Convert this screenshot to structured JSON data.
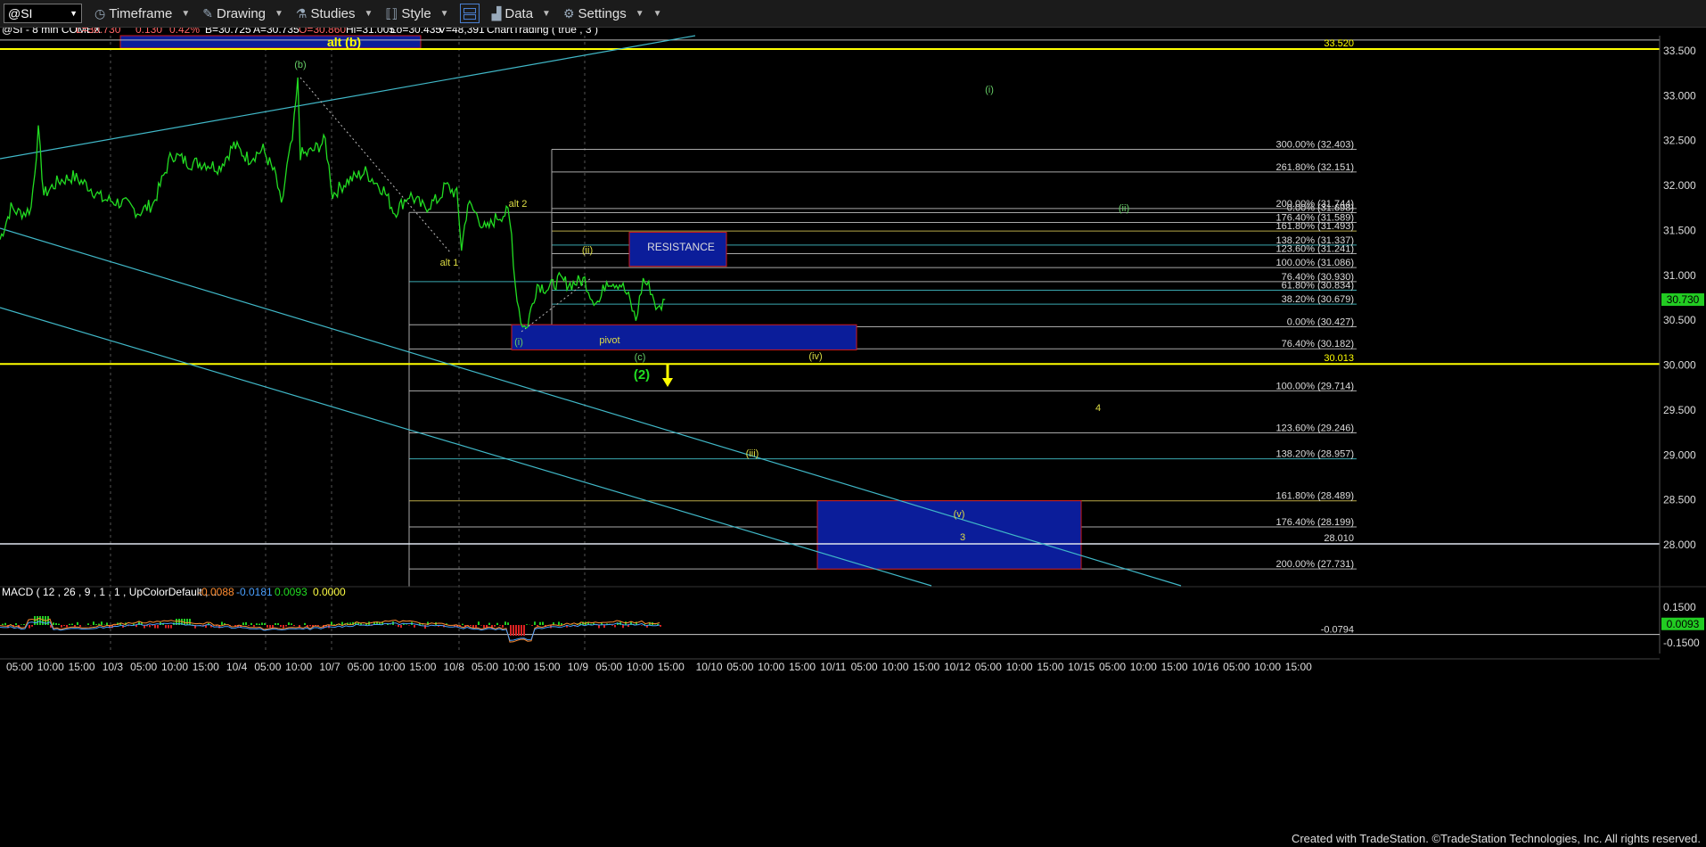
{
  "toolbar": {
    "symbol": "@SI",
    "timeframe": "Timeframe",
    "drawing": "Drawing",
    "studies": "Studies",
    "style": "Style",
    "data": "Data",
    "settings": "Settings"
  },
  "header": {
    "symbol_info": "@SI - 8 min  COMEX",
    "L": "L=30.730",
    "chg": "0.130",
    "pct": "0.42%",
    "B": "B=30.725",
    "A": "A=30.735",
    "O": "O=30.860",
    "Hi": "Hi=31.005",
    "Lo": "Lo=30.435",
    "V": "V=48,391",
    "study": "ChartTrading ( true , 3 )"
  },
  "colors": {
    "price": "#22dd22",
    "yellow": "#ffff00",
    "teal": "#40b8c8",
    "box_fill": "#0b1d9a",
    "box_border": "#d01818",
    "fib": "#a8a8a8",
    "grid": "#2a2a2a"
  },
  "chart_data": [
    {
      "type": "line",
      "name": "price",
      "yaxis": {
        "ylim": [
          27.4,
          33.75
        ],
        "ticks": [
          28.0,
          28.5,
          29.0,
          29.5,
          30.0,
          30.5,
          31.0,
          31.5,
          32.0,
          32.5,
          33.0,
          33.5
        ],
        "tick_labels": [
          "28.000",
          "28.500",
          "29.000",
          "29.500",
          "30.000",
          "30.500",
          "31.000",
          "31.500",
          "32.000",
          "32.500",
          "33.000",
          "33.500"
        ]
      },
      "x_labels": [
        "05:00",
        "10:00",
        "15:00",
        "10/3",
        "05:00",
        "10:00",
        "15:00",
        "10/4",
        "05:00",
        "10:00",
        "10/7",
        "05:00",
        "10:00",
        "15:00",
        "10/8",
        "05:00",
        "10:00",
        "15:00",
        "10/9",
        "05:00",
        "10:00",
        "15:00",
        "10/10",
        "05:00",
        "10:00",
        "15:00",
        "10/11",
        "05:00",
        "10:00",
        "15:00",
        "10/12",
        "05:00",
        "10:00",
        "15:00",
        "10/15",
        "05:00",
        "10:00",
        "15:00",
        "10/16",
        "05:00",
        "10:00",
        "15:00"
      ],
      "day_separators": [
        "10/3",
        "10/4",
        "10/7",
        "10/8",
        "10/9"
      ],
      "path": [
        [
          0,
          31.4
        ],
        [
          0.03,
          31.75
        ],
        [
          0.05,
          31.7
        ],
        [
          0.07,
          31.7
        ],
        [
          0.085,
          31.75
        ],
        [
          0.105,
          32.6
        ],
        [
          0.12,
          31.9
        ],
        [
          0.16,
          32.05
        ],
        [
          0.2,
          32.1
        ],
        [
          0.24,
          32.0
        ],
        [
          0.28,
          31.85
        ],
        [
          0.34,
          31.8
        ],
        [
          0.38,
          31.7
        ],
        [
          0.42,
          31.8
        ],
        [
          0.47,
          32.35
        ],
        [
          0.52,
          32.25
        ],
        [
          0.56,
          32.25
        ],
        [
          0.6,
          32.2
        ],
        [
          0.64,
          32.45
        ],
        [
          0.68,
          32.3
        ],
        [
          0.72,
          32.4
        ],
        [
          0.755,
          32.1
        ],
        [
          0.77,
          31.75
        ],
        [
          0.785,
          32.2
        ],
        [
          0.8,
          32.5
        ],
        [
          0.815,
          33.15
        ],
        [
          0.822,
          32.35
        ],
        [
          0.84,
          32.35
        ],
        [
          0.86,
          32.4
        ],
        [
          0.89,
          32.5
        ],
        [
          0.91,
          31.9
        ],
        [
          0.95,
          32.05
        ],
        [
          1.0,
          32.15
        ],
        [
          1.05,
          31.95
        ],
        [
          1.08,
          31.7
        ],
        [
          1.12,
          31.9
        ],
        [
          1.16,
          31.75
        ],
        [
          1.2,
          31.85
        ],
        [
          1.22,
          32.0
        ],
        [
          1.25,
          31.9
        ],
        [
          1.263,
          31.3
        ],
        [
          1.28,
          31.8
        ],
        [
          1.3,
          31.7
        ],
        [
          1.33,
          31.5
        ],
        [
          1.36,
          31.65
        ],
        [
          1.39,
          31.7
        ],
        [
          1.4,
          31.45
        ],
        [
          1.41,
          30.9
        ],
        [
          1.425,
          30.5
        ],
        [
          1.44,
          30.4
        ],
        [
          1.47,
          30.9
        ],
        [
          1.5,
          30.85
        ],
        [
          1.53,
          30.95
        ],
        [
          1.56,
          30.9
        ],
        [
          1.6,
          30.95
        ],
        [
          1.62,
          30.75
        ],
        [
          1.64,
          30.7
        ],
        [
          1.66,
          30.95
        ],
        [
          1.7,
          30.9
        ],
        [
          1.72,
          30.75
        ],
        [
          1.74,
          30.5
        ],
        [
          1.76,
          30.95
        ],
        [
          1.78,
          30.85
        ],
        [
          1.8,
          30.6
        ],
        [
          1.82,
          30.73
        ]
      ],
      "annotations": {
        "alt_b": "alt (b)",
        "b": "(b)",
        "alt_1": "alt 1",
        "alt_2": "alt 2",
        "ii_small": "(ii)",
        "i_small": "(i)",
        "pivot": "pivot",
        "c": "(c)",
        "iv": "(iv)",
        "wave_2": "(2)",
        "iii": "(iii)",
        "v": "(v)",
        "three": "3",
        "four": "4",
        "i_right": "(i)",
        "ii_right": "(ii)",
        "resistance": "RESISTANCE"
      },
      "horizontal_lines": [
        {
          "value": 33.52,
          "label": "33.520"
        },
        {
          "value": 30.013,
          "label": "30.013"
        },
        {
          "value": 28.01,
          "label": "28.010"
        }
      ],
      "fib_upper": [
        {
          "label": "300.00% (32.403)",
          "value": 32.403
        },
        {
          "label": "261.80% (32.151)",
          "value": 32.151
        },
        {
          "label": "200.00% (31.744)",
          "value": 31.744
        },
        {
          "label": "0.00% (31.698)",
          "value": 31.698
        },
        {
          "label": "176.40% (31.589)",
          "value": 31.589
        },
        {
          "label": "161.80% (31.493)",
          "value": 31.493
        },
        {
          "label": "138.20% (31.337)",
          "value": 31.337
        },
        {
          "label": "123.60% (31.241)",
          "value": 31.241
        },
        {
          "label": "100.00% (31.086)",
          "value": 31.086
        },
        {
          "label": "76.40% (30.930)",
          "value": 30.93
        },
        {
          "label": "61.80% (30.834)",
          "value": 30.834
        },
        {
          "label": "38.20% (30.679)",
          "value": 30.679
        },
        {
          "label": "0.00% (30.427)",
          "value": 30.427
        },
        {
          "label": "76.40% (30.182)",
          "value": 30.182
        }
      ],
      "fib_lower": [
        {
          "label": "100.00% (29.714)",
          "value": 29.714
        },
        {
          "label": "123.60% (29.246)",
          "value": 29.246
        },
        {
          "label": "138.20% (28.957)",
          "value": 28.957
        },
        {
          "label": "161.80% (28.489)",
          "value": 28.489
        },
        {
          "label": "176.40% (28.199)",
          "value": 28.199
        },
        {
          "label": "200.00% (27.731)",
          "value": 27.731
        }
      ],
      "last_price": {
        "value": 30.73,
        "label": "30.730"
      },
      "boxes": [
        {
          "name": "resistance-box",
          "y0": 31.1,
          "y1": 31.48
        },
        {
          "name": "pivot-box",
          "y0": 30.17,
          "y1": 30.45
        },
        {
          "name": "target-box",
          "y0": 27.73,
          "y1": 28.49
        },
        {
          "name": "alt-b-box",
          "y0": 33.53,
          "y1": 33.75
        }
      ]
    },
    {
      "type": "line",
      "name": "MACD",
      "legend": "MACD ( 12 , 26 , 9 , 1 , 1 , UpColorDefault , ...",
      "values_text": [
        "-0.0088",
        "-0.0181",
        "0.0093",
        "0.0000"
      ],
      "ylim": [
        -0.175,
        0.185
      ],
      "ticks": [
        0.15,
        -0.15
      ],
      "tick_labels": [
        "0.1500",
        "-0.1500"
      ],
      "level_line": {
        "value": -0.0794,
        "label": "-0.0794"
      },
      "last_value": {
        "value": 0.0093,
        "label": "0.0093"
      }
    }
  ],
  "footer": "Created with TradeStation. ©TradeStation Technologies, Inc. All rights reserved."
}
